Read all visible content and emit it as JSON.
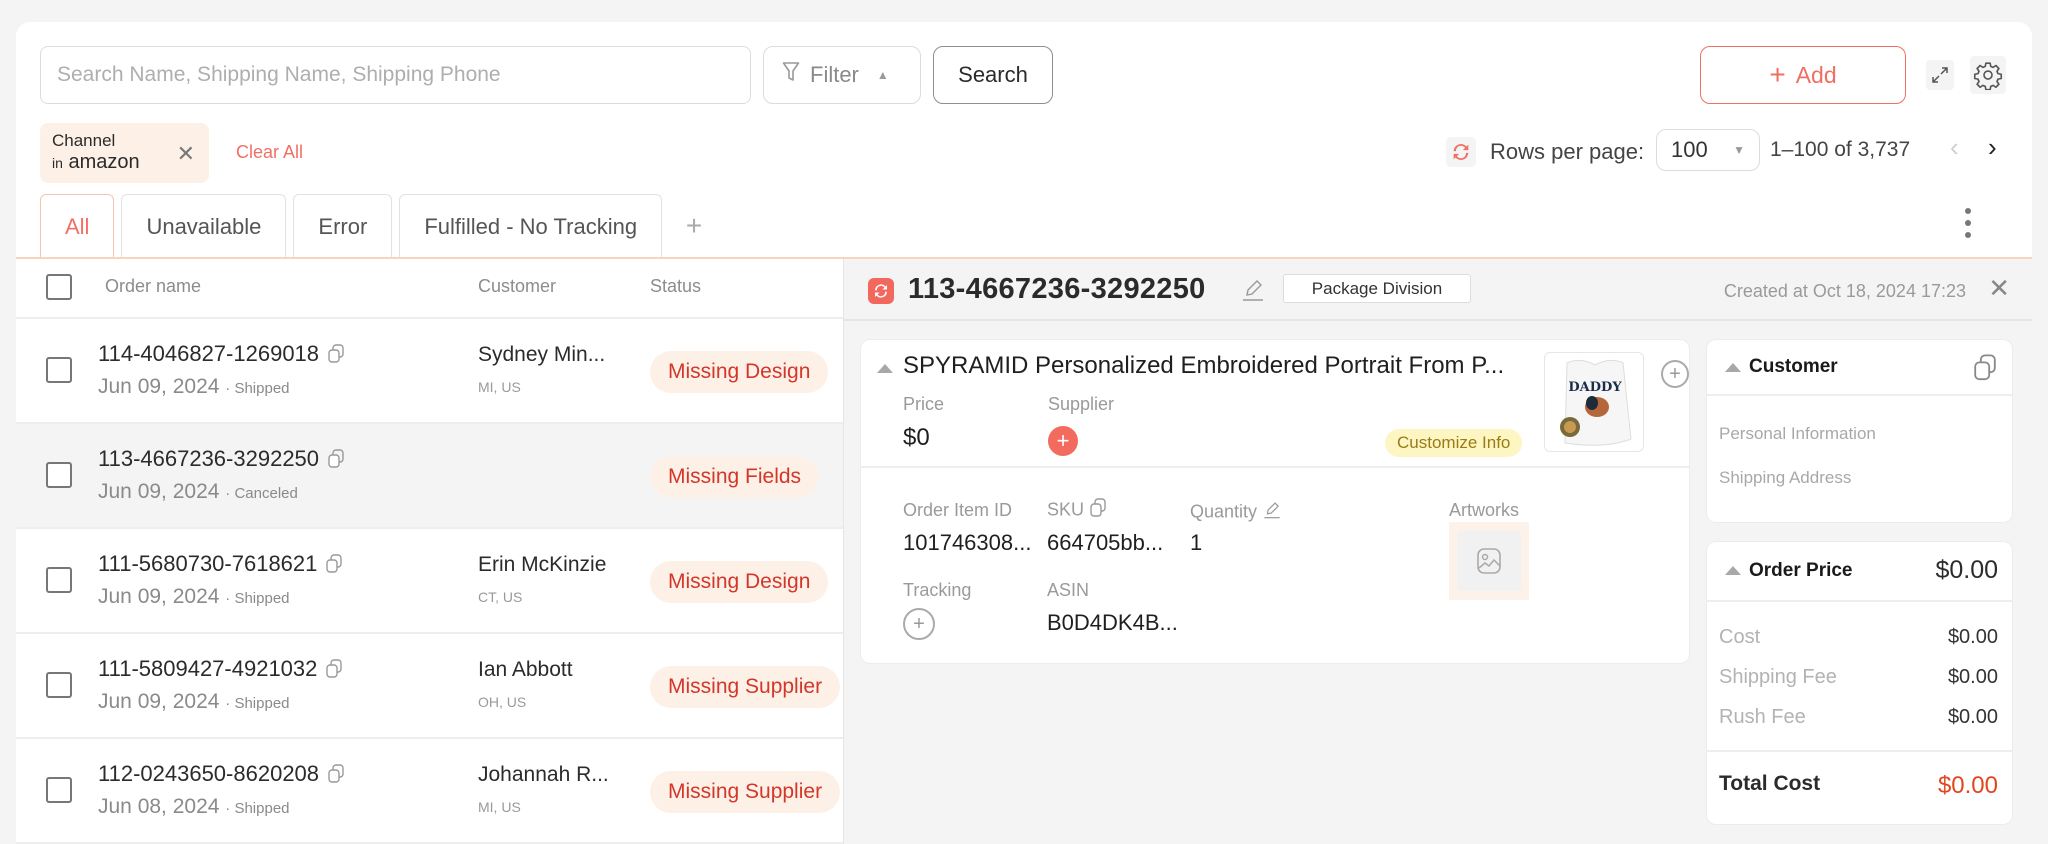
{
  "toolbar": {
    "search_placeholder": "Search Name, Shipping Name, Shipping Phone",
    "search_value": "",
    "filter_label": "Filter",
    "search_button": "Search",
    "add_button": "Add"
  },
  "filters": {
    "chip_key": "Channel",
    "chip_op": "in",
    "chip_value": "amazon",
    "clear_all": "Clear All"
  },
  "pagination": {
    "rows_label": "Rows per page:",
    "rows_per_page": "100",
    "range": "1–100 of 3,737"
  },
  "tabs": [
    {
      "label": "All",
      "active": true
    },
    {
      "label": "Unavailable",
      "active": false
    },
    {
      "label": "Error",
      "active": false
    },
    {
      "label": "Fulfilled - No Tracking",
      "active": false
    }
  ],
  "list": {
    "columns": [
      "Order name",
      "Customer",
      "Status"
    ],
    "rows": [
      {
        "order": "114-4046827-1269018",
        "date": "Jun 09, 2024",
        "state": "Shipped",
        "customer": "Sydney Min...",
        "location": "MI, US",
        "status": "Missing Design",
        "selected": false
      },
      {
        "order": "113-4667236-3292250",
        "date": "Jun 09, 2024",
        "state": "Canceled",
        "customer": "",
        "location": "",
        "status": "Missing Fields",
        "selected": true
      },
      {
        "order": "111-5680730-7618621",
        "date": "Jun 09, 2024",
        "state": "Shipped",
        "customer": "Erin McKinzie",
        "location": "CT, US",
        "status": "Missing Design",
        "selected": false
      },
      {
        "order": "111-5809427-4921032",
        "date": "Jun 09, 2024",
        "state": "Shipped",
        "customer": "Ian Abbott",
        "location": "OH, US",
        "status": "Missing Supplier",
        "selected": false
      },
      {
        "order": "112-0243650-8620208",
        "date": "Jun 08, 2024",
        "state": "Shipped",
        "customer": "Johannah R...",
        "location": "MI, US",
        "status": "Missing Supplier",
        "selected": false
      }
    ]
  },
  "detail": {
    "order_id": "113-4667236-3292250",
    "package_division": "Package Division",
    "created_at": "Created at Oct 18, 2024 17:23",
    "item": {
      "title": "SPYRAMID Personalized Embroidered Portrait From P...",
      "price_label": "Price",
      "price": "$0",
      "supplier_label": "Supplier",
      "customize_label": "Customize Info",
      "thumb_text": "DADDY",
      "order_item_id_label": "Order Item ID",
      "order_item_id": "101746308...",
      "sku_label": "SKU",
      "sku": "664705bb...",
      "quantity_label": "Quantity",
      "quantity": "1",
      "artworks_label": "Artworks",
      "tracking_label": "Tracking",
      "asin_label": "ASIN",
      "asin": "B0D4DK4B..."
    },
    "customer": {
      "title": "Customer",
      "personal_info": "Personal Information",
      "shipping_address": "Shipping Address"
    },
    "order_price": {
      "title": "Order Price",
      "total": "$0.00",
      "lines": [
        {
          "label": "Cost",
          "value": "$0.00"
        },
        {
          "label": "Shipping Fee",
          "value": "$0.00"
        },
        {
          "label": "Rush Fee",
          "value": "$0.00"
        }
      ],
      "total_cost_label": "Total Cost",
      "total_cost": "$0.00"
    }
  },
  "colors": {
    "accent": "#f07065",
    "status_text": "#d2372a",
    "status_bg": "#fdf0e6",
    "total_cost": "#e2461f"
  }
}
